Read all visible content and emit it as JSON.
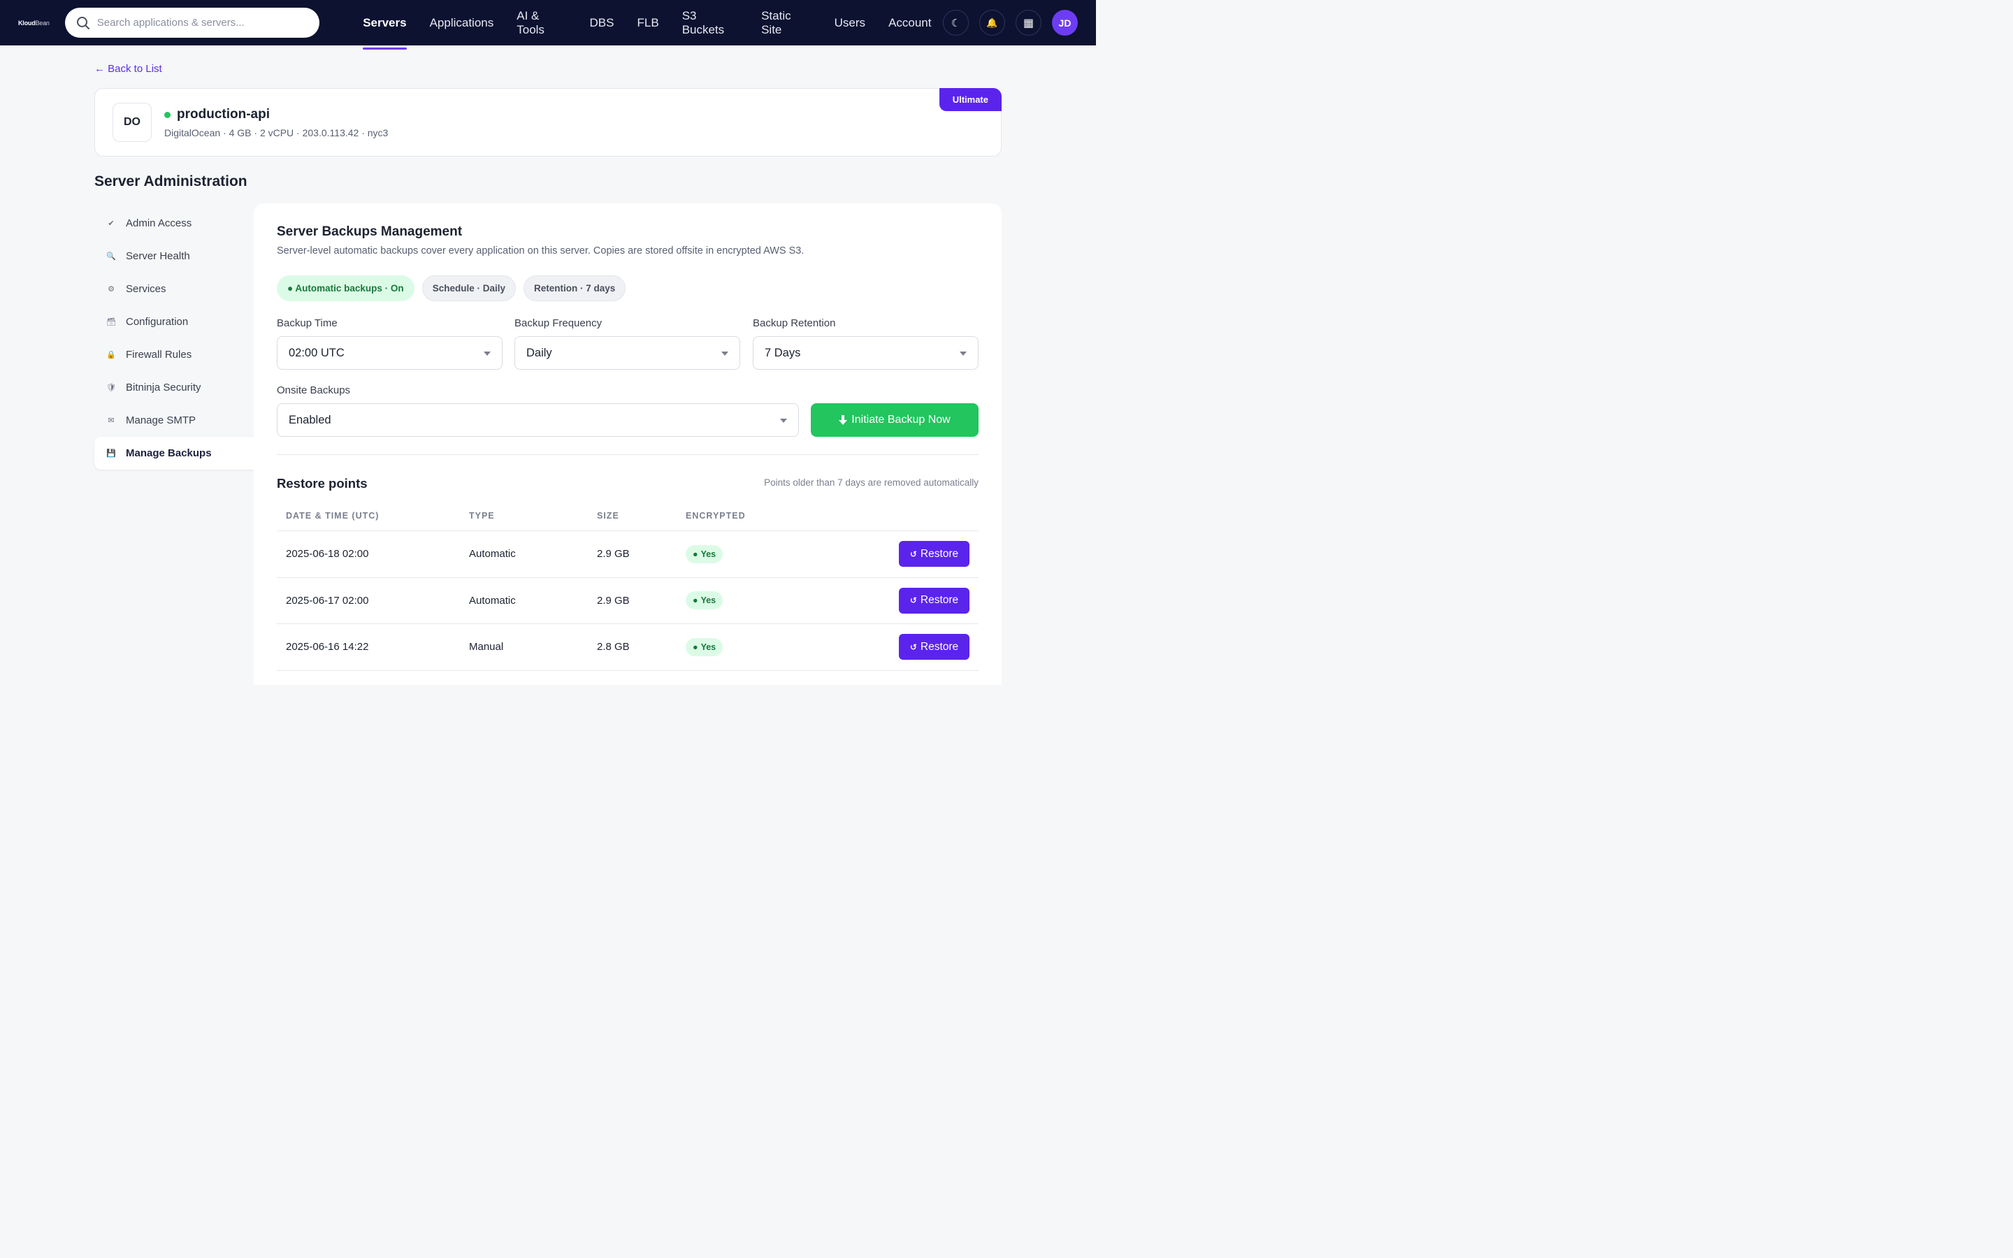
{
  "brand": {
    "logo_bold": "Kloud",
    "logo_thin": "Bean"
  },
  "search": {
    "placeholder": "Search applications & servers..."
  },
  "nav": {
    "items": [
      "Servers",
      "Applications",
      "AI & Tools",
      "DBS",
      "FLB",
      "S3 Buckets",
      "Static Site",
      "Users",
      "Account"
    ],
    "active": "Servers",
    "avatar_initials": "JD",
    "theme_icon": "☾",
    "bell_icon": "🔔",
    "apps_icon": "▦"
  },
  "back_link": "← Back to List",
  "server": {
    "badge": "DO",
    "name": "production-api",
    "meta": "DigitalOcean · 4 GB · 2 vCPU · 203.0.113.42 · nyc3",
    "plan": "Ultimate",
    "status_color": "#22c55e"
  },
  "section_title": "Server Administration",
  "sidebar": {
    "items": [
      {
        "label": "Admin Access",
        "icon": "✔"
      },
      {
        "label": "Server Health",
        "icon": "🔍"
      },
      {
        "label": "Services",
        "icon": "⚙"
      },
      {
        "label": "Configuration",
        "icon": "🗃"
      },
      {
        "label": "Firewall Rules",
        "icon": "🔒"
      },
      {
        "label": "Bitninja Security",
        "icon": "🛡"
      },
      {
        "label": "Manage SMTP",
        "icon": "✉"
      },
      {
        "label": "Manage Backups",
        "icon": "💾"
      }
    ],
    "active": "Manage Backups"
  },
  "panel": {
    "title": "Server Backups Management",
    "description": "Server-level automatic backups cover every application on this server. Copies are stored offsite in encrypted AWS S3.",
    "chips": [
      "● Automatic backups · On",
      "Schedule · Daily",
      "Retention · 7 days"
    ],
    "fields": {
      "backup_time": {
        "label": "Backup Time",
        "value": "02:00 UTC"
      },
      "backup_frequency": {
        "label": "Backup Frequency",
        "value": "Daily"
      },
      "backup_retention": {
        "label": "Backup Retention",
        "value": "7 Days"
      },
      "onsite_backups": {
        "label": "Onsite Backups",
        "value": "Enabled"
      }
    },
    "initiate_button": "Initiate Backup Now",
    "restore_points_title": "Restore points",
    "restore_points_note": "Points older than 7 days are removed automatically",
    "table": {
      "headers": [
        "DATE & TIME (UTC)",
        "TYPE",
        "SIZE",
        "ENCRYPTED"
      ],
      "rows": [
        {
          "date": "2025-06-18 02:00",
          "type": "Automatic",
          "size": "2.9 GB",
          "encrypted": "Yes"
        },
        {
          "date": "2025-06-17 02:00",
          "type": "Automatic",
          "size": "2.9 GB",
          "encrypted": "Yes"
        },
        {
          "date": "2025-06-16 14:22",
          "type": "Manual",
          "size": "2.8 GB",
          "encrypted": "Yes"
        }
      ],
      "restore_label": "Restore"
    }
  },
  "colors": {
    "nav_bg": "#0c1230",
    "accent": "#5b24ec",
    "success": "#22c55e"
  }
}
